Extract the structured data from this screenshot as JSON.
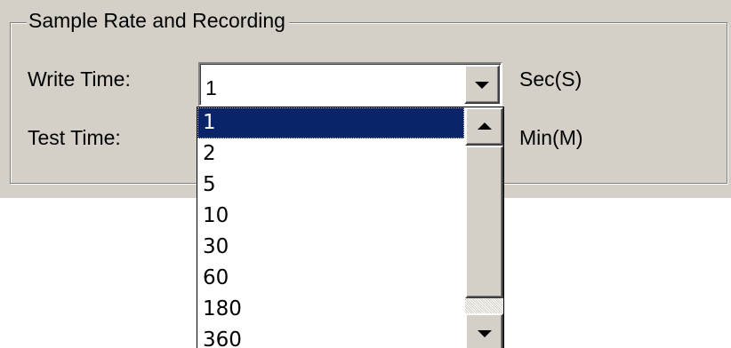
{
  "group": {
    "title": "Sample Rate and Recording"
  },
  "write_time": {
    "label": "Write Time:",
    "value": "1",
    "unit": "Sec(S)"
  },
  "test_time": {
    "label": "Test Time:",
    "unit": "Min(M)"
  },
  "dropdown": {
    "options": [
      "1",
      "2",
      "5",
      "10",
      "30",
      "60",
      "180",
      "360"
    ],
    "selected": "1"
  },
  "icons": {
    "dropdown_arrow": "chevron-down-icon",
    "scroll_up": "scroll-up-arrow-icon",
    "scroll_down": "scroll-down-arrow-icon"
  },
  "colors": {
    "panel": "#d4d0c8",
    "selection": "#0a246a"
  }
}
